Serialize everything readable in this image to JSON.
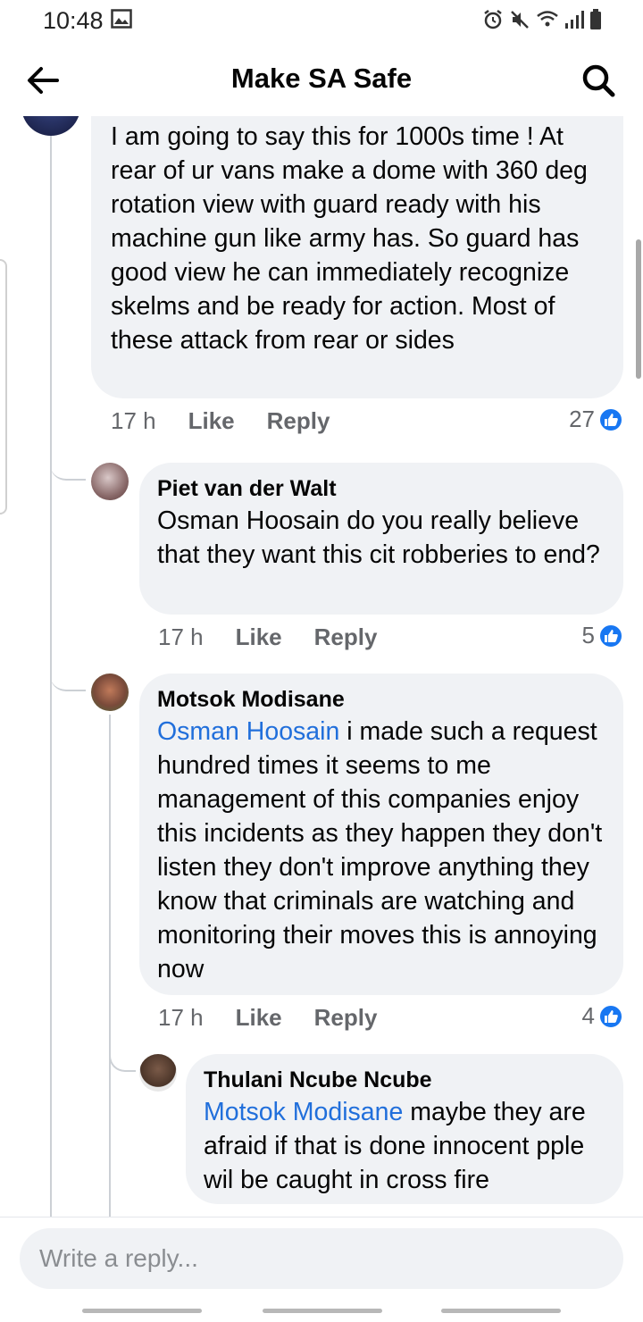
{
  "status": {
    "time": "10:48"
  },
  "header": {
    "title": "Make SA Safe"
  },
  "comments": [
    {
      "author": "",
      "text": "I am going to say this for 1000s time !  At rear of ur vans make a dome with 360 deg rotation view with guard ready with his machine gun like army has. So guard has good view he can immediately recognize skelms and be ready for action.   Most of these attack from rear or sides",
      "time": "17 h",
      "like": "Like",
      "reply": "Reply",
      "reactions": "27"
    },
    {
      "author": "Piet van der Walt",
      "text": "Osman Hoosain do you really believe that they want this cit robberies to end?",
      "time": "17 h",
      "like": "Like",
      "reply": "Reply",
      "reactions": "5"
    },
    {
      "author": "Motsok Modisane",
      "mention": "Osman Hoosain",
      "text": " i made such a request hundred times it seems to me management of this companies enjoy this incidents as they happen they don't listen they don't improve anything they know that criminals are watching and monitoring their moves this is annoying now",
      "time": "17 h",
      "like": "Like",
      "reply": "Reply",
      "reactions": "4"
    },
    {
      "author": "Thulani Ncube Ncube",
      "mention": "Motsok Modisane",
      "text": " maybe they are afraid if that is done innocent pple wil be caught in cross fire"
    }
  ],
  "composer": {
    "placeholder": "Write a reply..."
  },
  "colors": {
    "accent": "#1877f2",
    "bubble": "#f0f2f5",
    "mention": "#216fdb",
    "meta": "#65676b"
  }
}
